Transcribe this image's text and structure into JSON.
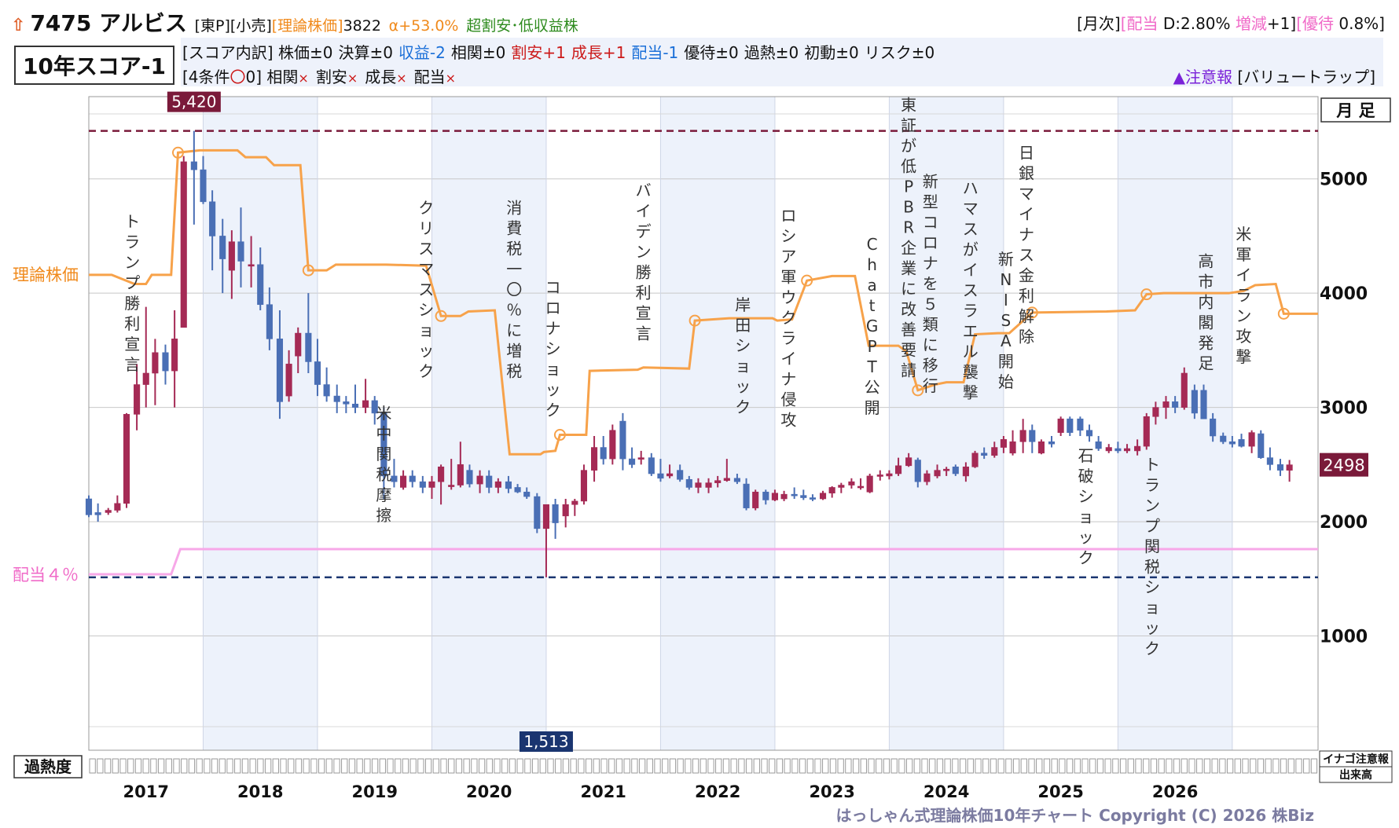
{
  "header": {
    "trend_icon": "up-arrow-icon",
    "code": "7475",
    "name": "アルビス",
    "market": "[東P]",
    "sector": "[小売]",
    "theory_label": "[理論株価]",
    "theory_value": "3822",
    "alpha": "α+53.0%",
    "verdict": "超割安･低収益株",
    "right_monthly": "[月次]",
    "right_div_label": "[配当",
    "right_div_value": "D:2.80%",
    "right_change_label": "増減",
    "right_change_value": "+1]",
    "right_yutai_label": "[優待",
    "right_yutai_value": "0.8%]"
  },
  "score": {
    "label": "10年スコア-1",
    "breakdown_prefix": "[スコア内訳]",
    "items": [
      {
        "text": "株価±0",
        "color": "#111111"
      },
      {
        "text": "決算±0",
        "color": "#111111"
      },
      {
        "text": "収益-2",
        "color": "#1a6fd8"
      },
      {
        "text": "相関±0",
        "color": "#111111"
      },
      {
        "text": "割安+1",
        "color": "#cc1a1a"
      },
      {
        "text": "成長+1",
        "color": "#cc1a1a"
      },
      {
        "text": "配当-1",
        "color": "#1a6fd8"
      },
      {
        "text": "優待±0",
        "color": "#111111"
      },
      {
        "text": "過熱±0",
        "color": "#111111"
      },
      {
        "text": "初動±0",
        "color": "#111111"
      },
      {
        "text": "リスク±0",
        "color": "#111111"
      }
    ],
    "conditions_prefix": "[4条件",
    "conditions_mark": "〇",
    "conditions_count": "0]",
    "conditions": [
      {
        "label": "相関",
        "mark": "×"
      },
      {
        "label": "割安",
        "mark": "×"
      },
      {
        "label": "成長",
        "mark": "×"
      },
      {
        "label": "配当",
        "mark": "×"
      }
    ],
    "warning": "▲注意報",
    "warning_type": "[バリュートラップ]"
  },
  "chart_data": {
    "type": "candlestick",
    "timeframe_label": "月 足",
    "x_tick_labels": [
      "2017",
      "2018",
      "2019",
      "2020",
      "2021",
      "2022",
      "2023",
      "2024",
      "2025",
      "2026"
    ],
    "y_ticks": [
      1000,
      2000,
      3000,
      4000,
      5000
    ],
    "ylim": [
      0,
      5720
    ],
    "xlim": [
      2016.0,
      2026.75
    ],
    "grid": true,
    "high_label": "5,420",
    "high_value": 5420,
    "low_label": "1,513",
    "low_value": 1513,
    "last_price_label": "2498",
    "last_price": 2498,
    "theory_line_label": "理論株価",
    "dividend_line_label": "配当４％",
    "overheat_label": "過熱度",
    "overheat_cells": 161,
    "right_box_top": "イナゴ注意報",
    "right_box_bottom": "出来高",
    "colors": {
      "up": "#a52a55",
      "down": "#4a6fb5",
      "theory": "#f7a24a",
      "dividend": "#f7a8e8",
      "high_line": "#7a1a3a",
      "low_line": "#1a3570",
      "band": "#edf2fb"
    },
    "theory_line": [
      [
        2016.0,
        4160
      ],
      [
        2016.2,
        4160
      ],
      [
        2016.4,
        4080
      ],
      [
        2016.5,
        4080
      ],
      [
        2016.55,
        4160
      ],
      [
        2016.72,
        4160
      ],
      [
        2016.78,
        5230
      ],
      [
        2016.97,
        5250
      ],
      [
        2017.3,
        5250
      ],
      [
        2017.37,
        5190
      ],
      [
        2017.55,
        5190
      ],
      [
        2017.62,
        5120
      ],
      [
        2017.85,
        5120
      ],
      [
        2017.92,
        4200
      ],
      [
        2018.08,
        4200
      ],
      [
        2018.16,
        4250
      ],
      [
        2018.6,
        4250
      ],
      [
        2018.95,
        4240
      ],
      [
        2019.08,
        3800
      ],
      [
        2019.25,
        3800
      ],
      [
        2019.32,
        3840
      ],
      [
        2019.55,
        3850
      ],
      [
        2019.68,
        2590
      ],
      [
        2019.95,
        2590
      ],
      [
        2019.98,
        2610
      ],
      [
        2020.08,
        2620
      ],
      [
        2020.12,
        2760
      ],
      [
        2020.35,
        2760
      ],
      [
        2020.38,
        3320
      ],
      [
        2020.8,
        3330
      ],
      [
        2020.85,
        3350
      ],
      [
        2021.25,
        3340
      ],
      [
        2021.3,
        3760
      ],
      [
        2021.6,
        3780
      ],
      [
        2021.98,
        3780
      ],
      [
        2022.02,
        3760
      ],
      [
        2022.15,
        3770
      ],
      [
        2022.28,
        4110
      ],
      [
        2022.5,
        4150
      ],
      [
        2022.7,
        4150
      ],
      [
        2022.82,
        3540
      ],
      [
        2023.08,
        3540
      ],
      [
        2023.15,
        3490
      ],
      [
        2023.25,
        3150
      ],
      [
        2023.4,
        3200
      ],
      [
        2023.5,
        3220
      ],
      [
        2023.65,
        3220
      ],
      [
        2023.75,
        3640
      ],
      [
        2023.95,
        3650
      ],
      [
        2024.05,
        3650
      ],
      [
        2024.25,
        3830
      ],
      [
        2024.9,
        3840
      ],
      [
        2025.15,
        3850
      ],
      [
        2025.25,
        3990
      ],
      [
        2025.4,
        4000
      ],
      [
        2025.97,
        4000
      ],
      [
        2026.1,
        4020
      ],
      [
        2026.2,
        4070
      ],
      [
        2026.38,
        4080
      ],
      [
        2026.45,
        3820
      ],
      [
        2026.55,
        3820
      ],
      [
        2026.75,
        3820
      ]
    ],
    "theory_markers": [
      [
        2016.78,
        5230
      ],
      [
        2017.92,
        4200
      ],
      [
        2019.08,
        3800
      ],
      [
        2020.12,
        2760
      ],
      [
        2021.3,
        3760
      ],
      [
        2022.28,
        4110
      ],
      [
        2023.25,
        3150
      ],
      [
        2024.25,
        3830
      ],
      [
        2025.25,
        3990
      ],
      [
        2026.45,
        3820
      ]
    ],
    "dividend_line": [
      [
        2016.0,
        1540
      ],
      [
        2016.72,
        1540
      ],
      [
        2016.8,
        1760
      ],
      [
        2026.75,
        1760
      ]
    ],
    "events": [
      {
        "text": "トランプ勝利宣言",
        "x": 2016.38,
        "y": 4580
      },
      {
        "text": "米中関税摩擦",
        "x": 2018.58,
        "y": 2900
      },
      {
        "text": "クリスマスショック",
        "x": 2018.95,
        "y": 4700
      },
      {
        "text": "消費税一〇％に増税",
        "x": 2019.72,
        "y": 4700
      },
      {
        "text": "コロナショック",
        "x": 2020.06,
        "y": 4000
      },
      {
        "text": "バイデン勝利宣言",
        "x": 2020.85,
        "y": 4850
      },
      {
        "text": "岸田ショック",
        "x": 2021.72,
        "y": 3850
      },
      {
        "text": "ロシア軍ウクライナ侵攻",
        "x": 2022.12,
        "y": 4630
      },
      {
        "text": "ChatGPT公開",
        "x": 2022.85,
        "y": 4380
      },
      {
        "text": "東証が低PBR企業に改善要請",
        "x": 2023.17,
        "y": 5600
      },
      {
        "text": "新型コロナを５類に移行",
        "x": 2023.36,
        "y": 4930
      },
      {
        "text": "ハマスがイスラエル襲撃",
        "x": 2023.71,
        "y": 4870
      },
      {
        "text": "新NISA開始",
        "x": 2024.02,
        "y": 4250
      },
      {
        "text": "日銀マイナス金利解除",
        "x": 2024.2,
        "y": 5180
      },
      {
        "text": "石破ショック",
        "x": 2024.72,
        "y": 2530
      },
      {
        "text": "トランプ関税ショック",
        "x": 2025.3,
        "y": 2450
      },
      {
        "text": "高市内閣発足",
        "x": 2025.77,
        "y": 4230
      },
      {
        "text": "米軍イラン攻撃",
        "x": 2026.1,
        "y": 4470
      }
    ],
    "candles": [
      [
        2016.0,
        2200,
        2230,
        2040,
        2060
      ],
      [
        2016.08,
        2080,
        2160,
        2000,
        2060
      ],
      [
        2016.17,
        2080,
        2120,
        2060,
        2100
      ],
      [
        2016.25,
        2100,
        2230,
        2080,
        2160
      ],
      [
        2016.33,
        2160,
        2950,
        2120,
        2940
      ],
      [
        2016.42,
        2940,
        3380,
        2800,
        3200
      ],
      [
        2016.5,
        3200,
        3880,
        3000,
        3300
      ],
      [
        2016.58,
        3300,
        3600,
        3020,
        3480
      ],
      [
        2016.67,
        3480,
        3550,
        3200,
        3320
      ],
      [
        2016.75,
        3320,
        3850,
        3000,
        3600
      ],
      [
        2016.83,
        3700,
        5200,
        3700,
        5150
      ],
      [
        2016.92,
        5150,
        5420,
        4600,
        5080
      ],
      [
        2017.0,
        5080,
        5200,
        4780,
        4800
      ],
      [
        2017.08,
        4800,
        4900,
        4200,
        4500
      ],
      [
        2017.17,
        4500,
        4650,
        4000,
        4300
      ],
      [
        2017.25,
        4200,
        4550,
        3950,
        4450
      ],
      [
        2017.33,
        4450,
        4750,
        4050,
        4280
      ],
      [
        2017.42,
        4250,
        4500,
        4050,
        4250
      ],
      [
        2017.5,
        4250,
        4400,
        3850,
        3900
      ],
      [
        2017.58,
        3900,
        4050,
        3500,
        3600
      ],
      [
        2017.67,
        3600,
        3850,
        2900,
        3050
      ],
      [
        2017.75,
        3100,
        3500,
        3050,
        3380
      ],
      [
        2017.83,
        3450,
        3700,
        3300,
        3650
      ],
      [
        2017.92,
        3650,
        4000,
        3300,
        3400
      ],
      [
        2018.0,
        3400,
        3600,
        3100,
        3200
      ],
      [
        2018.08,
        3200,
        3350,
        3050,
        3100
      ],
      [
        2018.17,
        3100,
        3200,
        2950,
        3050
      ],
      [
        2018.25,
        3050,
        3100,
        2950,
        3030
      ],
      [
        2018.33,
        3030,
        3200,
        2950,
        3000
      ],
      [
        2018.42,
        3000,
        3250,
        2950,
        3060
      ],
      [
        2018.5,
        3060,
        3100,
        2850,
        2950
      ],
      [
        2018.58,
        2950,
        3000,
        2200,
        2400
      ],
      [
        2018.67,
        2400,
        2550,
        2300,
        2350
      ],
      [
        2018.75,
        2300,
        2450,
        2280,
        2400
      ],
      [
        2018.83,
        2400,
        2450,
        2300,
        2350
      ],
      [
        2018.92,
        2350,
        2400,
        2250,
        2300
      ],
      [
        2019.0,
        2300,
        2400,
        2200,
        2350
      ],
      [
        2019.08,
        2350,
        2500,
        2150,
        2480
      ],
      [
        2019.17,
        2320,
        2550,
        2280,
        2320
      ],
      [
        2019.25,
        2320,
        2700,
        2300,
        2500
      ],
      [
        2019.33,
        2450,
        2500,
        2300,
        2330
      ],
      [
        2019.42,
        2330,
        2450,
        2250,
        2400
      ],
      [
        2019.5,
        2400,
        2450,
        2250,
        2300
      ],
      [
        2019.58,
        2300,
        2380,
        2250,
        2350
      ],
      [
        2019.67,
        2350,
        2400,
        2250,
        2290
      ],
      [
        2019.75,
        2300,
        2330,
        2250,
        2260
      ],
      [
        2019.83,
        2260,
        2300,
        2200,
        2220
      ],
      [
        2019.92,
        2220,
        2250,
        1900,
        1940
      ],
      [
        2020.0,
        1940,
        2050,
        1513,
        2150
      ],
      [
        2020.08,
        2150,
        2200,
        1850,
        1990
      ],
      [
        2020.17,
        2050,
        2200,
        1950,
        2150
      ],
      [
        2020.25,
        2150,
        2200,
        2050,
        2180
      ],
      [
        2020.33,
        2180,
        2500,
        2150,
        2450
      ],
      [
        2020.42,
        2450,
        2750,
        2350,
        2650
      ],
      [
        2020.5,
        2650,
        2750,
        2500,
        2550
      ],
      [
        2020.58,
        2550,
        2850,
        2500,
        2800
      ],
      [
        2020.67,
        2880,
        2950,
        2450,
        2550
      ],
      [
        2020.75,
        2550,
        2650,
        2470,
        2500
      ],
      [
        2020.83,
        2550,
        2620,
        2500,
        2560
      ],
      [
        2020.92,
        2560,
        2600,
        2400,
        2420
      ],
      [
        2021.0,
        2420,
        2550,
        2350,
        2380
      ],
      [
        2021.08,
        2400,
        2500,
        2380,
        2420
      ],
      [
        2021.17,
        2450,
        2500,
        2350,
        2370
      ],
      [
        2021.25,
        2370,
        2400,
        2280,
        2300
      ],
      [
        2021.33,
        2300,
        2380,
        2250,
        2340
      ],
      [
        2021.42,
        2300,
        2380,
        2250,
        2340
      ],
      [
        2021.5,
        2340,
        2400,
        2300,
        2360
      ],
      [
        2021.58,
        2360,
        2550,
        2350,
        2380
      ],
      [
        2021.67,
        2380,
        2420,
        2330,
        2350
      ],
      [
        2021.75,
        2330,
        2380,
        2100,
        2120
      ],
      [
        2021.83,
        2120,
        2280,
        2100,
        2260
      ],
      [
        2021.92,
        2260,
        2280,
        2150,
        2190
      ],
      [
        2022.0,
        2190,
        2280,
        2180,
        2250
      ],
      [
        2022.08,
        2200,
        2270,
        2180,
        2240
      ],
      [
        2022.17,
        2240,
        2300,
        2200,
        2230
      ],
      [
        2022.25,
        2230,
        2280,
        2190,
        2210
      ],
      [
        2022.33,
        2210,
        2240,
        2180,
        2200
      ],
      [
        2022.42,
        2200,
        2270,
        2190,
        2250
      ],
      [
        2022.5,
        2250,
        2310,
        2210,
        2300
      ],
      [
        2022.58,
        2300,
        2340,
        2250,
        2320
      ],
      [
        2022.67,
        2320,
        2380,
        2290,
        2350
      ],
      [
        2022.75,
        2300,
        2380,
        2280,
        2310
      ],
      [
        2022.83,
        2260,
        2420,
        2250,
        2400
      ],
      [
        2022.92,
        2400,
        2450,
        2360,
        2410
      ],
      [
        2023.0,
        2400,
        2450,
        2370,
        2420
      ],
      [
        2023.08,
        2420,
        2560,
        2400,
        2490
      ],
      [
        2023.17,
        2490,
        2600,
        2480,
        2560
      ],
      [
        2023.25,
        2540,
        2560,
        2300,
        2350
      ],
      [
        2023.33,
        2350,
        2450,
        2320,
        2420
      ],
      [
        2023.42,
        2400,
        2500,
        2380,
        2450
      ],
      [
        2023.5,
        2450,
        2480,
        2400,
        2460
      ],
      [
        2023.58,
        2480,
        2500,
        2400,
        2420
      ],
      [
        2023.67,
        2400,
        2520,
        2350,
        2480
      ],
      [
        2023.75,
        2480,
        2620,
        2470,
        2600
      ],
      [
        2023.83,
        2600,
        2650,
        2550,
        2580
      ],
      [
        2023.92,
        2580,
        2700,
        2560,
        2650
      ],
      [
        2024.0,
        2650,
        2750,
        2600,
        2720
      ],
      [
        2024.08,
        2600,
        2800,
        2580,
        2700
      ],
      [
        2024.17,
        2700,
        2900,
        2600,
        2800
      ],
      [
        2024.25,
        2800,
        2850,
        2600,
        2700
      ],
      [
        2024.33,
        2600,
        2720,
        2590,
        2700
      ],
      [
        2024.42,
        2700,
        2750,
        2650,
        2680
      ],
      [
        2024.5,
        2780,
        2920,
        2750,
        2900
      ],
      [
        2024.58,
        2900,
        2920,
        2750,
        2780
      ],
      [
        2024.67,
        2900,
        2920,
        2750,
        2800
      ],
      [
        2024.75,
        2800,
        2850,
        2700,
        2750
      ],
      [
        2024.83,
        2700,
        2750,
        2620,
        2640
      ],
      [
        2024.92,
        2620,
        2680,
        2600,
        2650
      ],
      [
        2025.0,
        2640,
        2700,
        2600,
        2620
      ],
      [
        2025.08,
        2620,
        2680,
        2600,
        2640
      ],
      [
        2025.17,
        2620,
        2720,
        2580,
        2660
      ],
      [
        2025.25,
        2660,
        2950,
        2630,
        2920
      ],
      [
        2025.33,
        2920,
        3050,
        2850,
        3000
      ],
      [
        2025.42,
        3000,
        3100,
        2900,
        3050
      ],
      [
        2025.5,
        3050,
        3100,
        2950,
        3000
      ],
      [
        2025.58,
        3000,
        3350,
        2980,
        3300
      ],
      [
        2025.67,
        3150,
        3200,
        2900,
        2950
      ],
      [
        2025.75,
        3150,
        3200,
        2900,
        2900
      ],
      [
        2025.83,
        2900,
        2950,
        2700,
        2750
      ],
      [
        2025.92,
        2750,
        2780,
        2680,
        2700
      ],
      [
        2026.0,
        2700,
        2750,
        2650,
        2680
      ],
      [
        2026.08,
        2720,
        2770,
        2650,
        2660
      ],
      [
        2026.17,
        2660,
        2800,
        2600,
        2780
      ],
      [
        2026.25,
        2770,
        2800,
        2550,
        2560
      ],
      [
        2026.33,
        2560,
        2650,
        2450,
        2500
      ],
      [
        2026.42,
        2500,
        2550,
        2400,
        2450
      ],
      [
        2026.5,
        2450,
        2540,
        2350,
        2498
      ]
    ]
  },
  "footer": {
    "copyright": "はっしゃん式理論株価10年チャート Copyright (C) 2026 株Biz"
  }
}
